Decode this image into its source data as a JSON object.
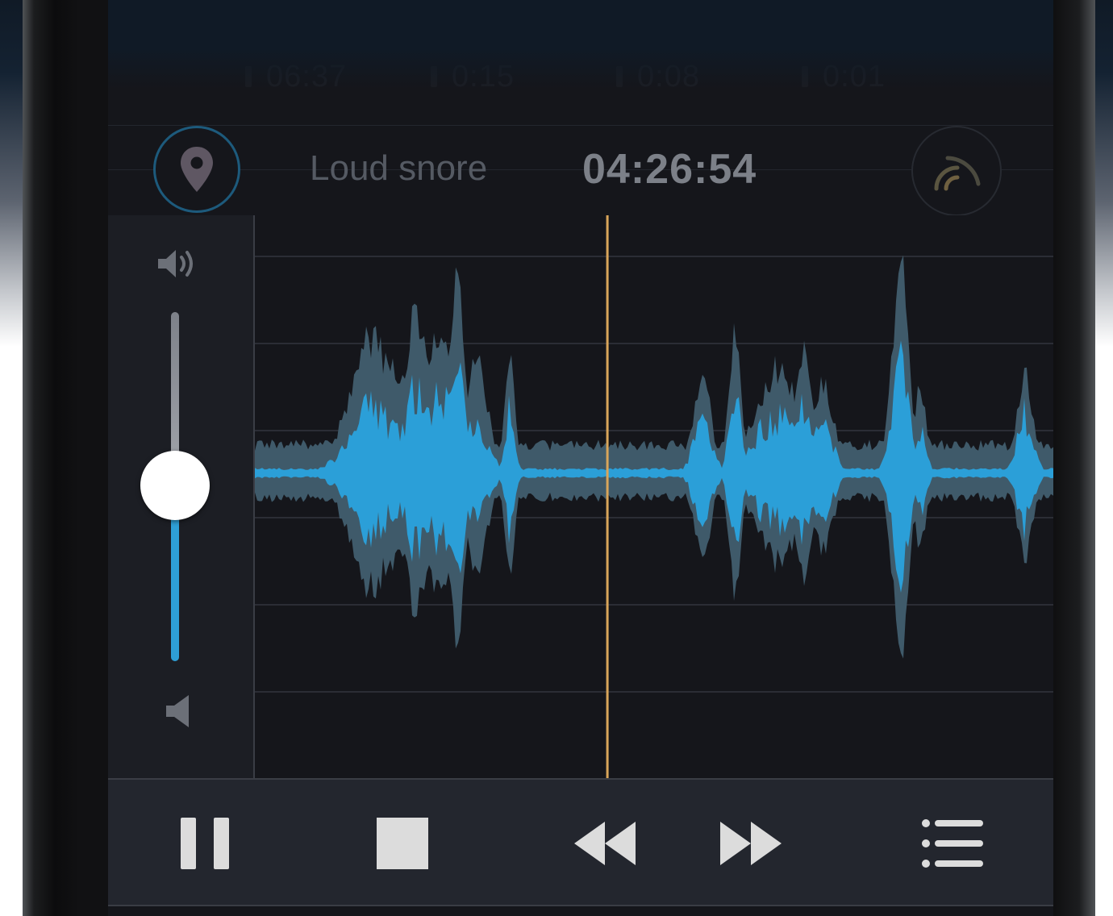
{
  "stats": [
    "06:37",
    "0:15",
    "0:08",
    "0:01"
  ],
  "event": {
    "label": "Loud snore",
    "time": "04:26:54"
  },
  "volume": {
    "level": 0.5
  },
  "playback": {
    "playhead_position": 0.44
  },
  "icons": {
    "location": "location-pin-icon",
    "snore": "snore-waves-icon",
    "volume_high": "volume-high-icon",
    "volume_low": "volume-low-icon",
    "pause": "pause-icon",
    "stop": "stop-icon",
    "rewind": "rewind-icon",
    "fast_forward": "fast-forward-icon",
    "list": "list-icon"
  },
  "colors": {
    "waveform_core": "#2b9fd8",
    "waveform_envelope": "#3f5a6a",
    "playhead": "#d9a55a",
    "slider_fill": "#2e9fd6",
    "accent_ring": "#1d5a7c"
  }
}
